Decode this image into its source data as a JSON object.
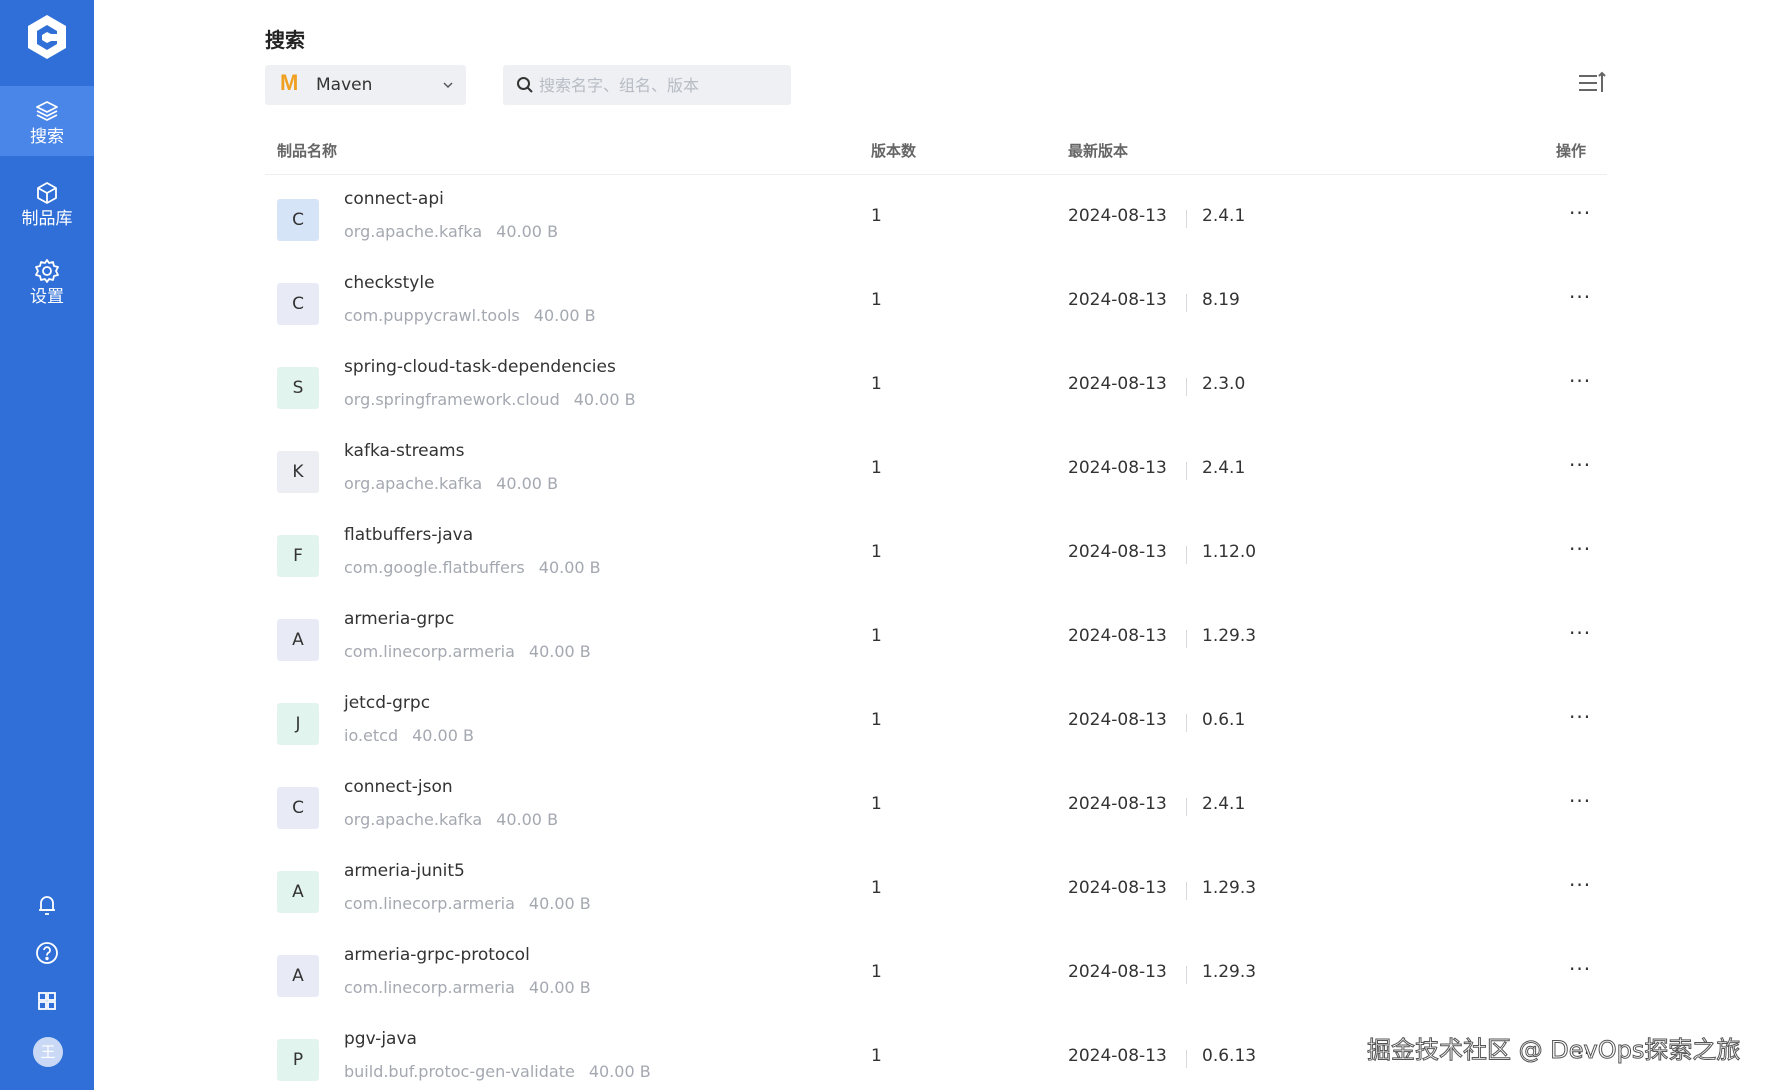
{
  "sidebar": {
    "nav": [
      {
        "label": "搜索",
        "icon": "layers-icon",
        "active": true
      },
      {
        "label": "制品库",
        "icon": "box-icon",
        "active": false
      },
      {
        "label": "设置",
        "icon": "gear-icon",
        "active": false
      }
    ],
    "bottom_icons": [
      "bell-icon",
      "help-icon",
      "apps-grid-icon"
    ],
    "avatar_text": "王"
  },
  "header": {
    "title": "搜索",
    "package_type": "Maven",
    "search_placeholder": "搜索名字、组名、版本"
  },
  "table": {
    "columns": [
      "制品名称",
      "版本数",
      "最新版本",
      "操作"
    ],
    "rows": [
      {
        "letter": "C",
        "name": "connect-api",
        "group": "org.apache.kafka",
        "size": "40.00 B",
        "count": "1",
        "date": "2024-08-13",
        "version": "2.4.1",
        "color": "#d6e4f7"
      },
      {
        "letter": "C",
        "name": "checkstyle",
        "group": "com.puppycrawl.tools",
        "size": "40.00 B",
        "count": "1",
        "date": "2024-08-13",
        "version": "8.19",
        "color": "#e8ebf5"
      },
      {
        "letter": "S",
        "name": "spring-cloud-task-dependencies",
        "group": "org.springframework.cloud",
        "size": "40.00 B",
        "count": "1",
        "date": "2024-08-13",
        "version": "2.3.0",
        "color": "#e2f4ee"
      },
      {
        "letter": "K",
        "name": "kafka-streams",
        "group": "org.apache.kafka",
        "size": "40.00 B",
        "count": "1",
        "date": "2024-08-13",
        "version": "2.4.1",
        "color": "#eceef3"
      },
      {
        "letter": "F",
        "name": "flatbuffers-java",
        "group": "com.google.flatbuffers",
        "size": "40.00 B",
        "count": "1",
        "date": "2024-08-13",
        "version": "1.12.0",
        "color": "#e2f4ee"
      },
      {
        "letter": "A",
        "name": "armeria-grpc",
        "group": "com.linecorp.armeria",
        "size": "40.00 B",
        "count": "1",
        "date": "2024-08-13",
        "version": "1.29.3",
        "color": "#e8ebf5"
      },
      {
        "letter": "J",
        "name": "jetcd-grpc",
        "group": "io.etcd",
        "size": "40.00 B",
        "count": "1",
        "date": "2024-08-13",
        "version": "0.6.1",
        "color": "#e2f4ee"
      },
      {
        "letter": "C",
        "name": "connect-json",
        "group": "org.apache.kafka",
        "size": "40.00 B",
        "count": "1",
        "date": "2024-08-13",
        "version": "2.4.1",
        "color": "#e8ebf5"
      },
      {
        "letter": "A",
        "name": "armeria-junit5",
        "group": "com.linecorp.armeria",
        "size": "40.00 B",
        "count": "1",
        "date": "2024-08-13",
        "version": "1.29.3",
        "color": "#e2f4ee"
      },
      {
        "letter": "A",
        "name": "armeria-grpc-protocol",
        "group": "com.linecorp.armeria",
        "size": "40.00 B",
        "count": "1",
        "date": "2024-08-13",
        "version": "1.29.3",
        "color": "#e8ebf5"
      },
      {
        "letter": "P",
        "name": "pgv-java",
        "group": "build.buf.protoc-gen-validate",
        "size": "40.00 B",
        "count": "1",
        "date": "2024-08-13",
        "version": "0.6.13",
        "color": "#e2f4ee"
      }
    ],
    "more_label": "···"
  },
  "watermark": "掘金技术社区 @ DevOps探索之旅",
  "colors": {
    "sidebar": "#2f6fd7",
    "sidebar_active": "#4a86e8",
    "maven": "#f0a020"
  }
}
